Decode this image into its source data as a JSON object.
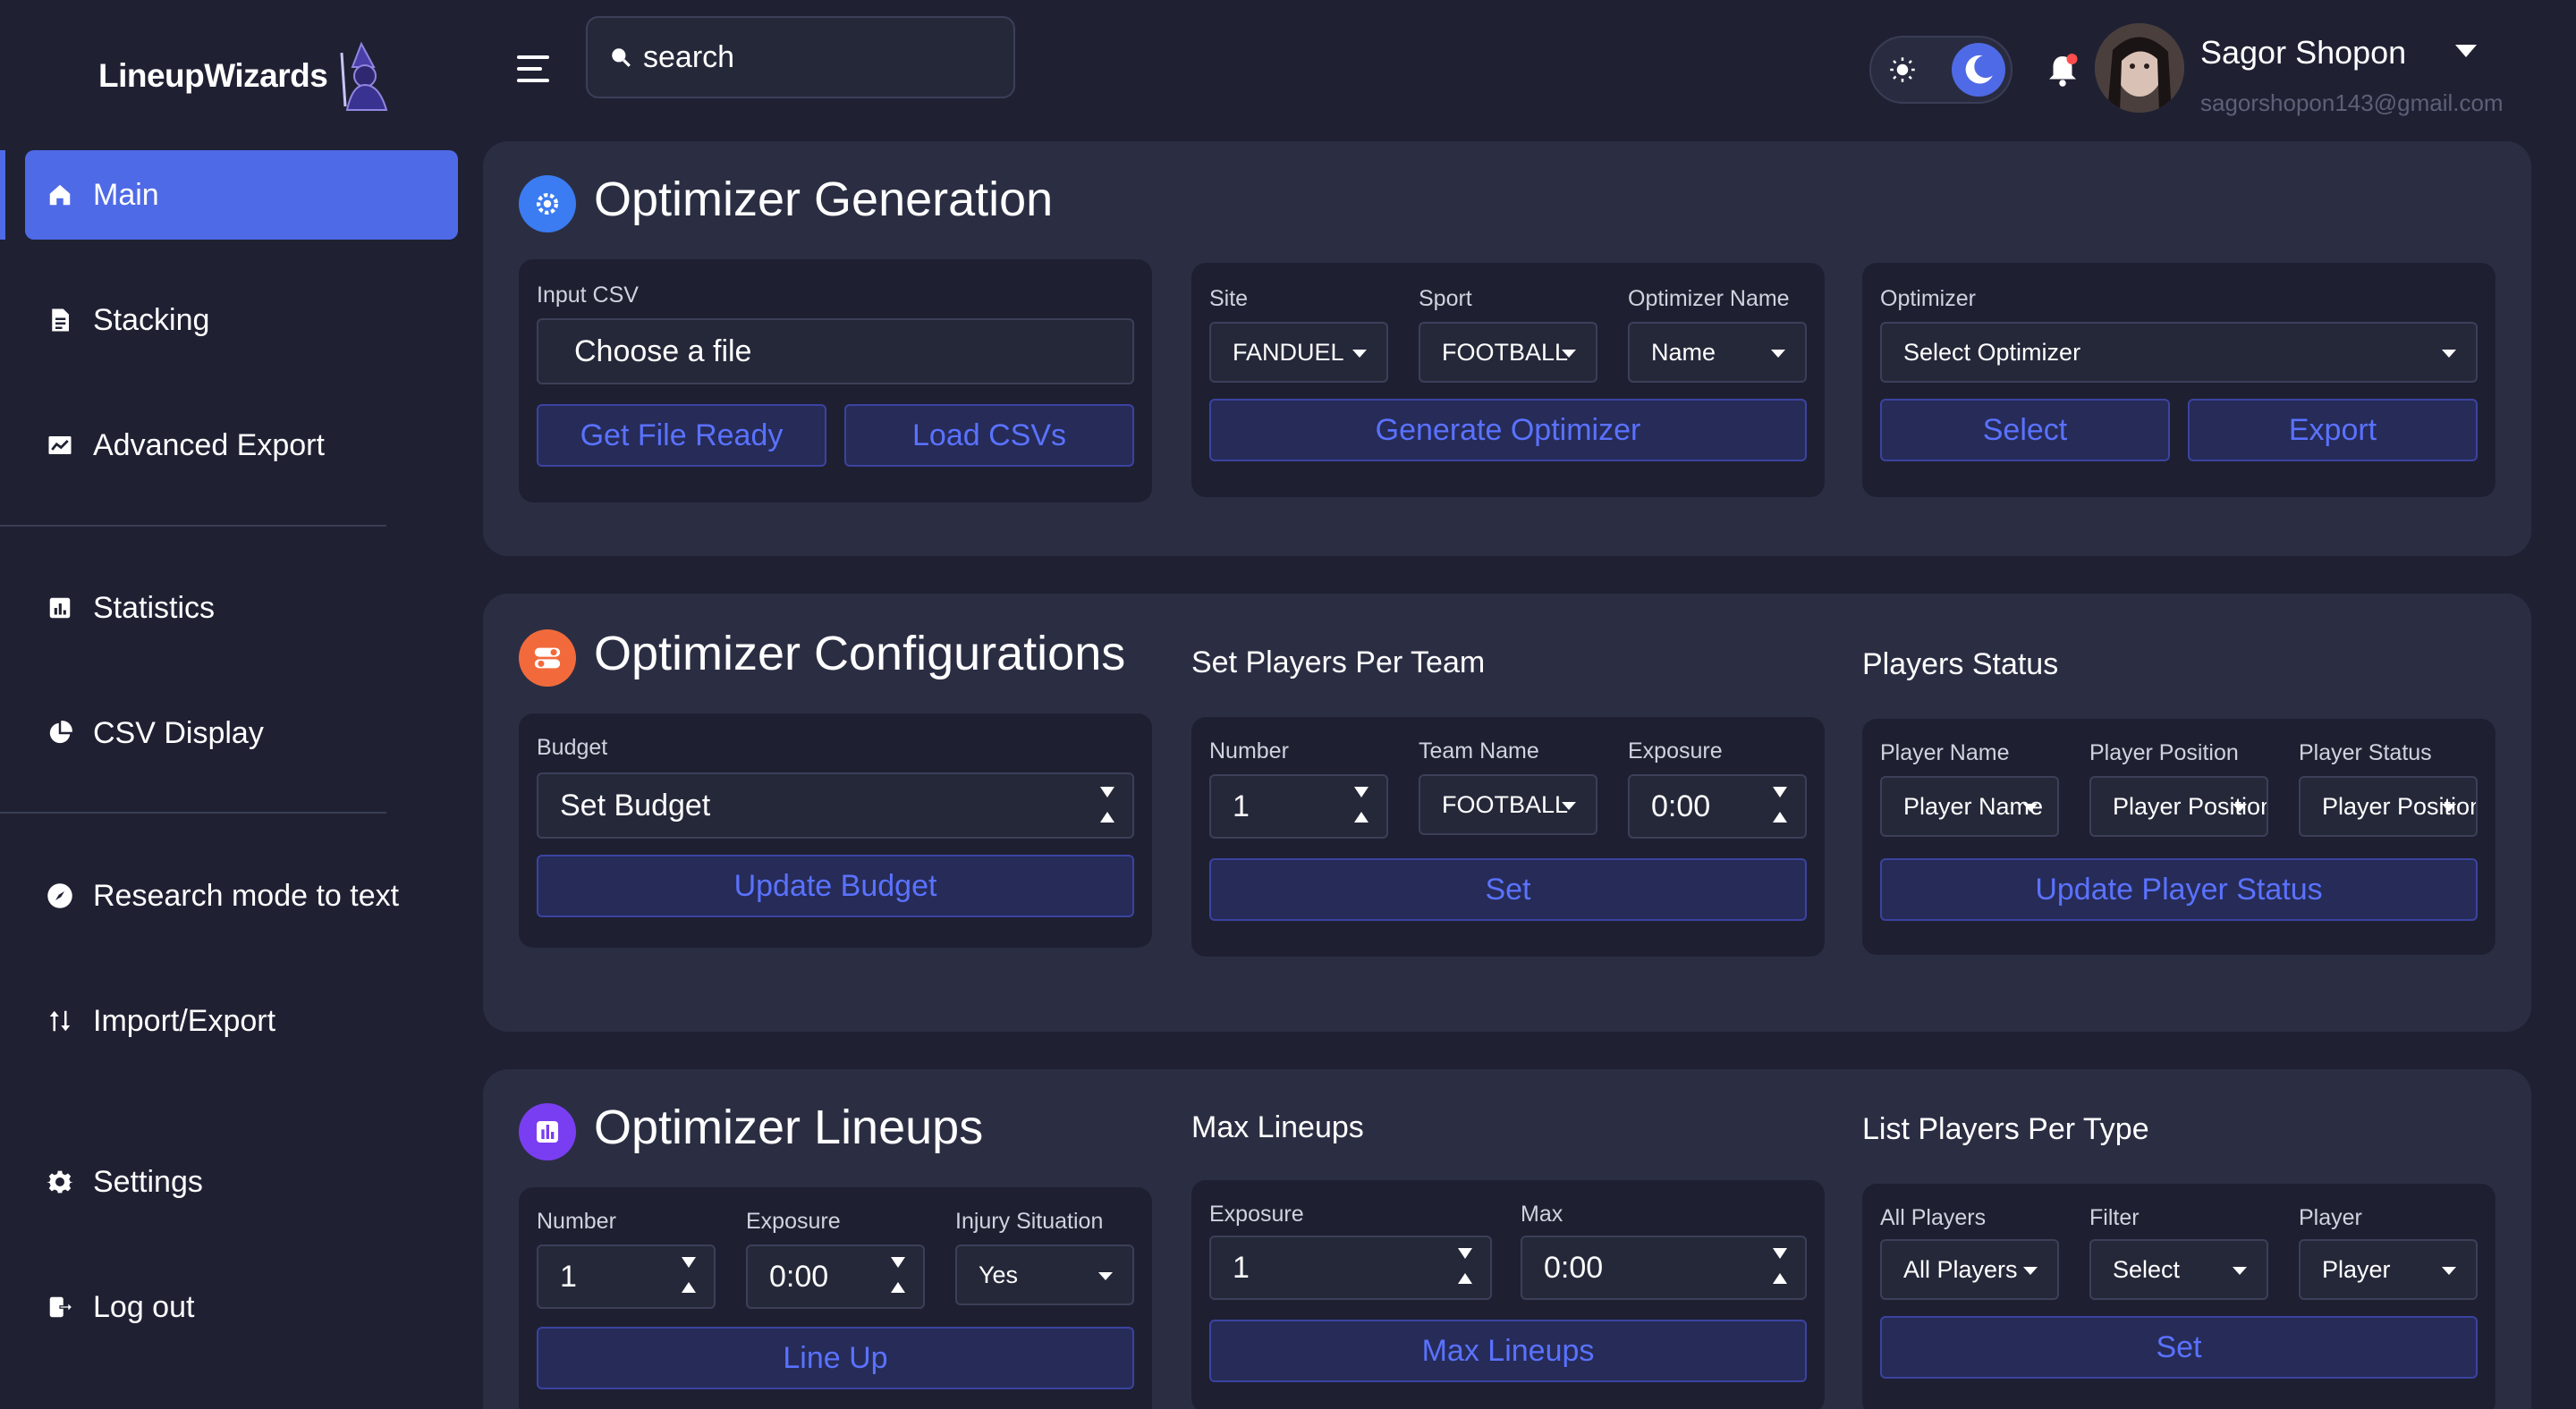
{
  "brand": {
    "name": "LineupWizards"
  },
  "search": {
    "placeholder": "search"
  },
  "user": {
    "name": "Sagor Shopon",
    "email": "sagorshopon143@gmail.com"
  },
  "colors": {
    "accent": "#4f6ae6",
    "background": "#1f2133",
    "panel": "#2b2e43",
    "card": "#1e2032",
    "button_text": "#5a72ff"
  },
  "sidebar": {
    "items": [
      {
        "label": "Main",
        "icon": "home-icon",
        "active": true
      },
      {
        "label": "Stacking",
        "icon": "document-icon"
      },
      {
        "label": "Advanced Export",
        "icon": "chart-line-icon"
      },
      {
        "label": "Statistics",
        "icon": "bar-chart-icon"
      },
      {
        "label": "CSV Display",
        "icon": "pie-chart-icon"
      },
      {
        "label": "Research mode to text",
        "icon": "compass-icon"
      },
      {
        "label": "Import/Export",
        "icon": "arrows-updown-icon"
      },
      {
        "label": "Settings",
        "icon": "gear-icon"
      },
      {
        "label": "Log out",
        "icon": "logout-icon"
      }
    ]
  },
  "generation": {
    "title": "Optimizer Generation",
    "input_csv": {
      "label": "Input CSV",
      "file_label": "Choose a file",
      "get_ready": "Get File Ready",
      "load": "Load CSVs"
    },
    "site": {
      "label": "Site",
      "value": "FANDUEL"
    },
    "sport": {
      "label": "Sport",
      "value": "FOOTBALL"
    },
    "optimizer_name": {
      "label": "Optimizer Name",
      "value": "Name"
    },
    "generate_button": "Generate Optimizer",
    "optimizer": {
      "label": "Optimizer",
      "value": "Select Optimizer",
      "select_button": "Select",
      "export_button": "Export"
    }
  },
  "configurations": {
    "title": "Optimizer Configurations",
    "budget": {
      "label": "Budget",
      "placeholder": "Set Budget",
      "button": "Update Budget"
    },
    "players_per_team": {
      "title": "Set Players Per Team",
      "number_label": "Number",
      "number_value": "1",
      "team_label": "Team Name",
      "team_value": "FOOTBALL",
      "exposure_label": "Exposure",
      "exposure_value": "0:00",
      "button": "Set"
    },
    "players_status": {
      "title": "Players Status",
      "name_label": "Player Name",
      "name_value": "Player Name",
      "position_label": "Player Position",
      "position_value": "Player Position",
      "status_label": "Player Status",
      "status_value": "Player Position",
      "button": "Update Player Status"
    }
  },
  "lineups": {
    "title": "Optimizer Lineups",
    "number_label": "Number",
    "number_value": "1",
    "exposure_label": "Exposure",
    "exposure_value": "0:00",
    "injury_label": "Injury Situation",
    "injury_value": "Yes",
    "button": "Line Up",
    "max_lineups": {
      "title": "Max Lineups",
      "exposure_label": "Exposure",
      "exposure_value": "1",
      "max_label": "Max",
      "max_value": "0:00",
      "button": "Max Lineups"
    },
    "per_type": {
      "title": "List Players Per Type",
      "all_label": "All Players",
      "all_value": "All Players",
      "filter_label": "Filter",
      "filter_value": "Select",
      "player_label": "Player",
      "player_value": "Player",
      "button": "Set"
    }
  }
}
